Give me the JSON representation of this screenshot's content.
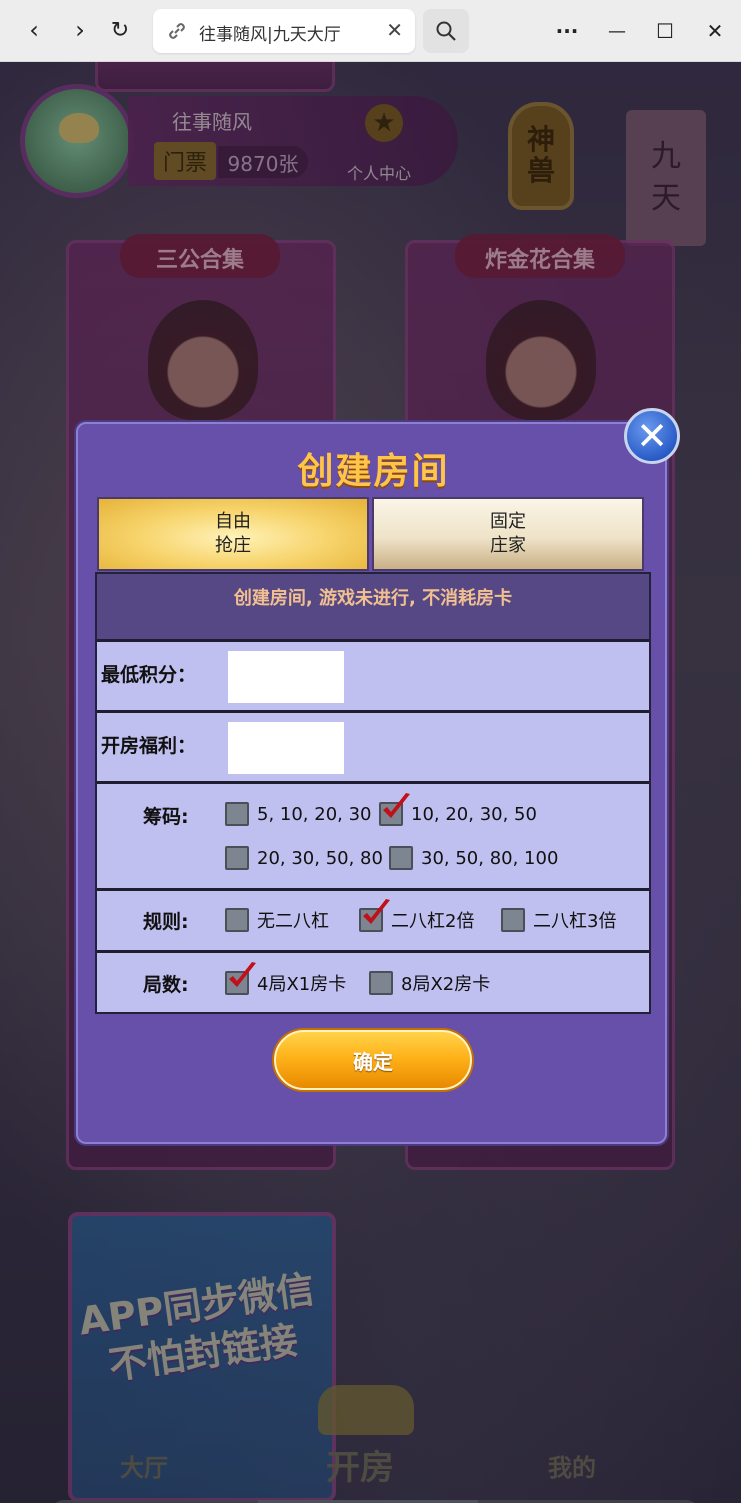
{
  "browser": {
    "tab_title": "往事随风|九天大厅",
    "tab_close": "✕",
    "back": "‹",
    "forward": "›",
    "reload": "↻",
    "more": "···",
    "minimize": "—",
    "maximize": "☐",
    "close": "✕"
  },
  "hall": {
    "username": "往事随风",
    "ticket_label": "门票",
    "ticket_count": "9870张",
    "center_label": "个人中心",
    "shenshou": "神\n兽",
    "jiutian": "九\n天",
    "card1_title": "三公合集",
    "card2_title": "炸金花合集",
    "promo_text": "APP同步微信\n不怕封链接",
    "nav_home": "大厅",
    "nav_open": "开房",
    "nav_mine": "我的"
  },
  "dialog": {
    "title": "创建房间",
    "close_icon": "✕",
    "tab_free_line1": "自由",
    "tab_free_line2": "抢庄",
    "tab_fixed_line1": "固定",
    "tab_fixed_line2": "庄家",
    "notice": "创建房间, 游戏未进行, 不消耗房卡",
    "min_score_label": "最低积分：",
    "min_score_value": "",
    "bonus_label": "开房福利：",
    "bonus_value": "",
    "chips_label": "筹码:",
    "chips_options": [
      {
        "label": "5, 10, 20, 30",
        "checked": false
      },
      {
        "label": "10, 20, 30, 50",
        "checked": true
      },
      {
        "label": "20, 30, 50, 80",
        "checked": false
      },
      {
        "label": "30, 50, 80, 100",
        "checked": false
      }
    ],
    "rules_label": "规则:",
    "rules_options": [
      {
        "label": "无二八杠",
        "checked": false
      },
      {
        "label": "二八杠2倍",
        "checked": true
      },
      {
        "label": "二八杠3倍",
        "checked": false
      }
    ],
    "rounds_label": "局数:",
    "rounds_options": [
      {
        "label": "4局X1房卡",
        "checked": true
      },
      {
        "label": "8局X2房卡",
        "checked": false
      }
    ],
    "confirm_label": "确定"
  },
  "colors": {
    "dialog_bg": "#6750a9",
    "title_gold": "#ffc44a",
    "form_bg": "#c0c0f0",
    "check_red": "#c0101a"
  }
}
